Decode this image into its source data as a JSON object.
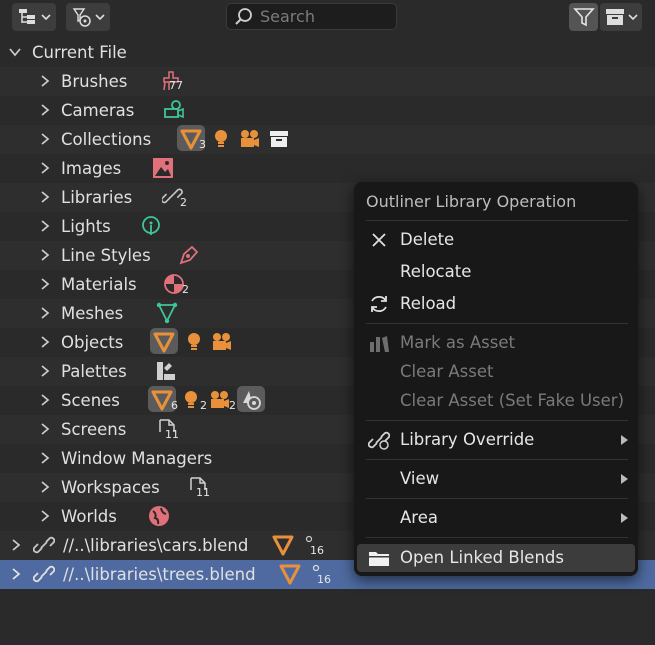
{
  "header": {
    "search_placeholder": "Search",
    "display_mode_icon": "outliner-tree-icon",
    "filter_icon": "funnel-icon",
    "sync_icon": "archive-box-icon"
  },
  "tree": {
    "root_label": "Current File",
    "items": [
      {
        "label": "Brushes",
        "icon": "brush-icon",
        "count": "77"
      },
      {
        "label": "Cameras",
        "icon": "camera-icon",
        "count": ""
      },
      {
        "label": "Collections",
        "icon": "collection-icon",
        "count": "3"
      },
      {
        "label": "Images",
        "icon": "image-icon",
        "count": ""
      },
      {
        "label": "Libraries",
        "icon": "link-icon",
        "count": "2"
      },
      {
        "label": "Lights",
        "icon": "light-icon",
        "count": ""
      },
      {
        "label": "Line Styles",
        "icon": "linestyle-icon",
        "count": ""
      },
      {
        "label": "Materials",
        "icon": "material-icon",
        "count": "2"
      },
      {
        "label": "Meshes",
        "icon": "mesh-icon",
        "count": ""
      },
      {
        "label": "Objects",
        "icon": "object-icon",
        "count": ""
      },
      {
        "label": "Palettes",
        "icon": "palette-icon",
        "count": ""
      },
      {
        "label": "Scenes",
        "icon": "scene-icon",
        "count": "6",
        "count2": "2",
        "count3": "2"
      },
      {
        "label": "Screens",
        "icon": "screen-icon",
        "count": "11"
      },
      {
        "label": "Window Managers",
        "icon": "",
        "count": ""
      },
      {
        "label": "Workspaces",
        "icon": "workspace-icon",
        "count": "11"
      },
      {
        "label": "Worlds",
        "icon": "world-icon",
        "count": ""
      }
    ],
    "libraries": [
      {
        "label": "//..\\libraries\\cars.blend",
        "count": "16"
      },
      {
        "label": "//..\\libraries\\trees.blend",
        "count": "16"
      }
    ]
  },
  "context_menu": {
    "title": "Outliner Library Operation",
    "items": [
      {
        "label": "Delete",
        "icon": "x-icon",
        "enabled": true
      },
      {
        "label": "Relocate",
        "icon": "",
        "enabled": true
      },
      {
        "label": "Reload",
        "icon": "reload-icon",
        "enabled": true
      },
      {
        "label": "Mark as Asset",
        "icon": "asset-icon",
        "enabled": false
      },
      {
        "label": "Clear Asset",
        "icon": "",
        "enabled": false
      },
      {
        "label": "Clear Asset (Set Fake User)",
        "icon": "",
        "enabled": false
      },
      {
        "label": "Library Override",
        "icon": "library-override-icon",
        "enabled": true,
        "submenu": true
      },
      {
        "label": "View",
        "icon": "",
        "enabled": true,
        "submenu": true
      },
      {
        "label": "Area",
        "icon": "",
        "enabled": true,
        "submenu": true
      },
      {
        "label": "Open Linked Blends",
        "icon": "folder-icon",
        "enabled": true,
        "highlighted": true
      }
    ]
  },
  "colors": {
    "orange": "#e8913a",
    "green": "#3ec69a",
    "red": "#e0707a",
    "selection": "#4e6aa0"
  }
}
